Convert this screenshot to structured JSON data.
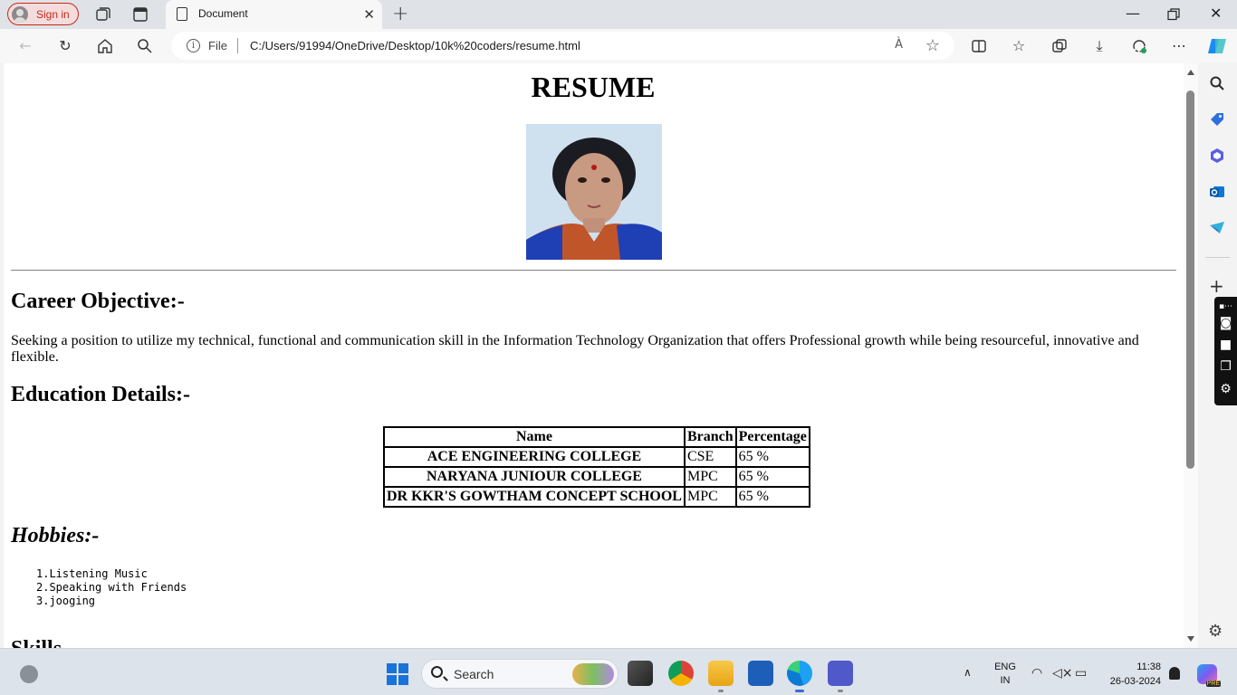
{
  "browser": {
    "signin_label": "Sign in",
    "tab_title": "Document",
    "file_label": "File",
    "url": "C:/Users/91994/OneDrive/Desktop/10k%20coders/resume.html",
    "read_aloud_label": "À"
  },
  "page": {
    "title": "RESUME",
    "career": {
      "heading": "Career Objective:-",
      "text": "Seeking a position to utilize my technical, functional and communication skill in the Information Technology Organization that offers Professional growth while being resourceful, innovative and flexible."
    },
    "education": {
      "heading": "Education Details:-",
      "columns": [
        "Name",
        "Branch",
        "Percentage"
      ],
      "rows": [
        {
          "name": "ACE ENGINEERING COLLEGE",
          "branch": "CSE",
          "percentage": "65 %"
        },
        {
          "name": "NARYANA JUNIOUR COLLEGE",
          "branch": "MPC",
          "percentage": "65 %"
        },
        {
          "name": "DR KKR'S GOWTHAM CONCEPT SCHOOL",
          "branch": "MPC",
          "percentage": "65 %"
        }
      ]
    },
    "hobbies": {
      "heading": "Hobbies:-",
      "items": [
        "1.Listening Music",
        "2.Speaking with Friends",
        "3.jooging"
      ]
    },
    "skills": {
      "heading": "Skills"
    }
  },
  "taskbar": {
    "search_placeholder": "Search",
    "lang_line1": "ENG",
    "lang_line2": "IN",
    "time": "11:38",
    "date": "26-03-2024",
    "copilot_badge": "PRE"
  },
  "colors": {
    "signin_accent": "#c42b1c",
    "windows_blue": "#1a73d8",
    "edge_blue": "#0c7bd6"
  }
}
